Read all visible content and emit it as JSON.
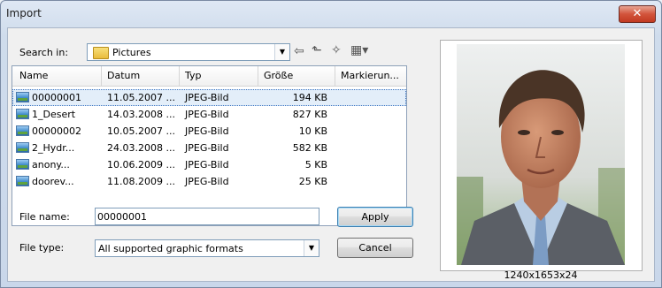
{
  "window": {
    "title": "Import",
    "close_label": "✕"
  },
  "search": {
    "label": "Search in:",
    "folder": "Pictures"
  },
  "columns": [
    "Name",
    "Datum",
    "Typ",
    "Größe",
    "Markierun..."
  ],
  "files": [
    {
      "name": "00000001",
      "date": "11.05.2007 ...",
      "type": "JPEG-Bild",
      "size": "194 KB"
    },
    {
      "name": "1_Desert",
      "date": "14.03.2008 ...",
      "type": "JPEG-Bild",
      "size": "827 KB"
    },
    {
      "name": "00000002",
      "date": "10.05.2007 ...",
      "type": "JPEG-Bild",
      "size": "10 KB"
    },
    {
      "name": "2_Hydr...",
      "date": "24.03.2008 ...",
      "type": "JPEG-Bild",
      "size": "582 KB"
    },
    {
      "name": "anony...",
      "date": "10.06.2009 ...",
      "type": "JPEG-Bild",
      "size": "5 KB"
    },
    {
      "name": "doorev...",
      "date": "11.08.2009 ...",
      "type": "JPEG-Bild",
      "size": "25 KB"
    }
  ],
  "file_name": {
    "label": "File name:",
    "value": "00000001"
  },
  "file_type": {
    "label": "File type:",
    "value": "All supported graphic formats"
  },
  "buttons": {
    "apply": "Apply",
    "cancel": "Cancel"
  },
  "preview": {
    "dimensions": "1240x1653x24"
  }
}
